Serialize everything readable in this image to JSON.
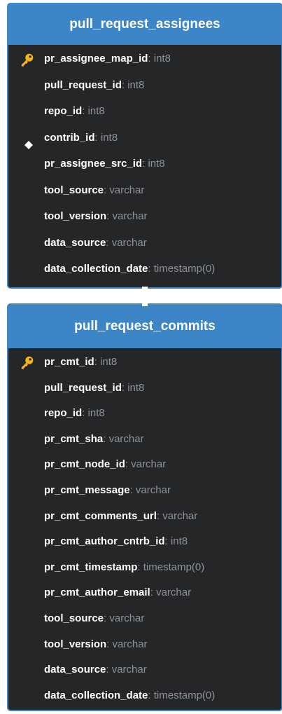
{
  "tables": [
    {
      "title": "pull_request_assignees",
      "fields": [
        {
          "name": "pr_assignee_map_id",
          "sep": ": ",
          "type": "int8",
          "marker": "primary-key"
        },
        {
          "name": "pull_request_id",
          "sep": ": ",
          "type": "int8",
          "marker": ""
        },
        {
          "name": "repo_id",
          "sep": ": ",
          "type": "int8",
          "marker": ""
        },
        {
          "name": "contrib_id",
          "sep": ": ",
          "type": "int8",
          "marker": "foreign-key"
        },
        {
          "name": "pr_assignee_src_id",
          "sep": ": ",
          "type": "int8",
          "marker": ""
        },
        {
          "name": "tool_source",
          "sep": ": ",
          "type": "varchar",
          "marker": ""
        },
        {
          "name": "tool_version",
          "sep": ": ",
          "type": "varchar",
          "marker": ""
        },
        {
          "name": "data_source",
          "sep": ": ",
          "type": "varchar",
          "marker": ""
        },
        {
          "name": "data_collection_date",
          "sep": ": ",
          "type": "timestamp(0)",
          "marker": ""
        }
      ]
    },
    {
      "title": "pull_request_commits",
      "fields": [
        {
          "name": "pr_cmt_id",
          "sep": ": ",
          "type": "int8",
          "marker": "primary-key"
        },
        {
          "name": "pull_request_id",
          "sep": ": ",
          "type": "int8",
          "marker": ""
        },
        {
          "name": "repo_id",
          "sep": ": ",
          "type": "int8",
          "marker": ""
        },
        {
          "name": "pr_cmt_sha",
          "sep": ": ",
          "type": "varchar",
          "marker": ""
        },
        {
          "name": "pr_cmt_node_id",
          "sep": ": ",
          "type": "varchar",
          "marker": ""
        },
        {
          "name": "pr_cmt_message",
          "sep": ": ",
          "type": "varchar",
          "marker": ""
        },
        {
          "name": "pr_cmt_comments_url",
          "sep": ": ",
          "type": "varchar",
          "marker": ""
        },
        {
          "name": "pr_cmt_author_cntrb_id",
          "sep": ": ",
          "type": "int8",
          "marker": ""
        },
        {
          "name": "pr_cmt_timestamp",
          "sep": ": ",
          "type": "timestamp(0)",
          "marker": ""
        },
        {
          "name": "pr_cmt_author_email",
          "sep": ": ",
          "type": "varchar",
          "marker": ""
        },
        {
          "name": "tool_source",
          "sep": ": ",
          "type": "varchar",
          "marker": ""
        },
        {
          "name": "tool_version",
          "sep": ": ",
          "type": "varchar",
          "marker": ""
        },
        {
          "name": "data_source",
          "sep": ": ",
          "type": "varchar",
          "marker": ""
        },
        {
          "name": "data_collection_date",
          "sep": ": ",
          "type": "timestamp(0)",
          "marker": ""
        }
      ]
    }
  ],
  "colors": {
    "header_bg": "#3c86c7",
    "card_bg": "#252628",
    "field_name": "#ffffff",
    "field_type": "#8f9296",
    "key_icon": "#f5b31b"
  },
  "icons": {
    "primary_key": "key-icon",
    "foreign_key": "diamond-icon"
  }
}
